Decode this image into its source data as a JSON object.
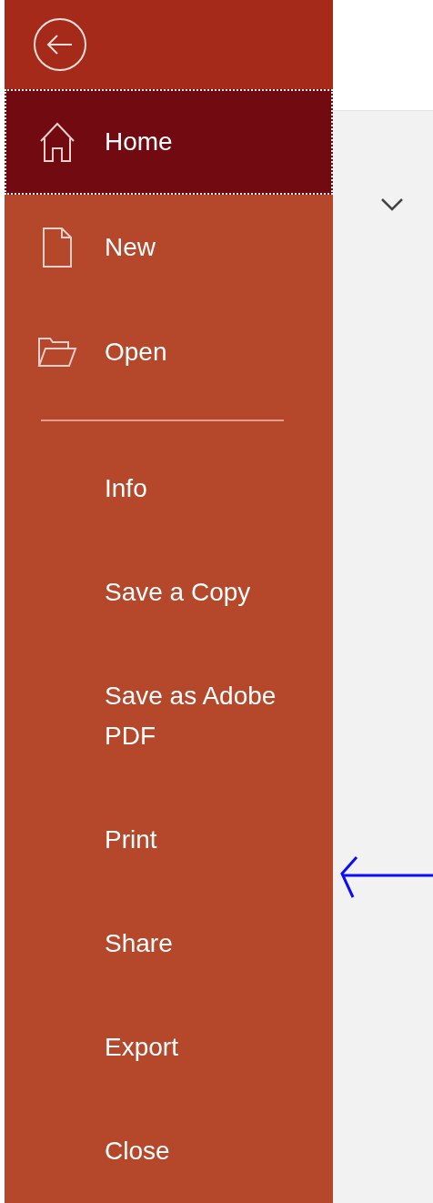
{
  "sidebar": {
    "primary_items": [
      {
        "label": "Home",
        "selected": true
      },
      {
        "label": "New",
        "selected": false
      },
      {
        "label": "Open",
        "selected": false
      }
    ],
    "secondary_items": [
      {
        "label": "Info",
        "selected": false
      },
      {
        "label": "Save a Copy",
        "selected": false
      },
      {
        "label": "Save as Adobe PDF",
        "selected": false
      },
      {
        "label": "Print",
        "selected": false
      },
      {
        "label": "Share",
        "selected": false
      },
      {
        "label": "Export",
        "selected": false
      },
      {
        "label": "Close",
        "selected": false
      }
    ]
  }
}
